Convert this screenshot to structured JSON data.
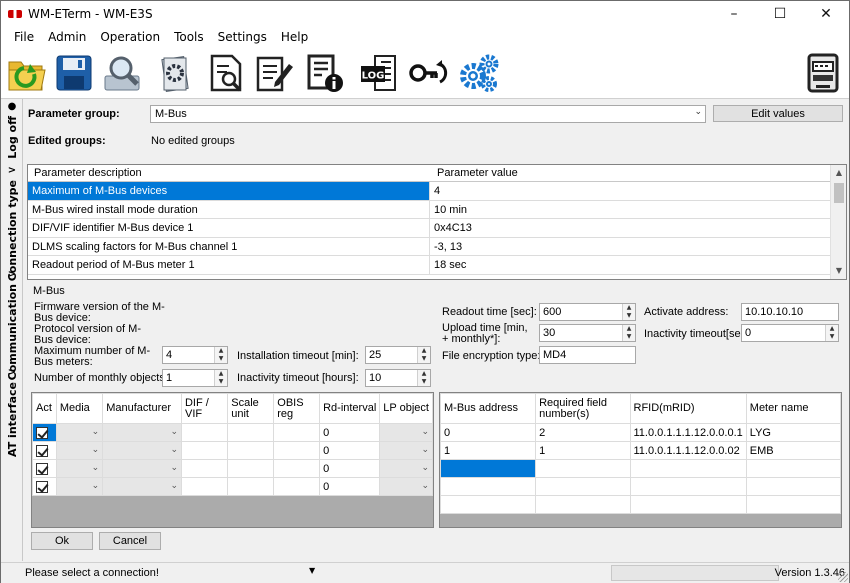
{
  "window": {
    "title": "WM-ETerm - WM-E3S"
  },
  "menu": [
    "File",
    "Admin",
    "Operation",
    "Tools",
    "Settings",
    "Help"
  ],
  "toolbar": {
    "log_label": "LOG"
  },
  "sidetabs": [
    "Log off",
    "Connection type",
    "Communication",
    "AT interface"
  ],
  "param_group": {
    "label": "Parameter group:",
    "value": "M-Bus",
    "edit_button": "Edit values"
  },
  "edited_groups": {
    "label": "Edited groups:",
    "value": "No edited groups"
  },
  "param_table": {
    "headers": [
      "Parameter description",
      "Parameter value"
    ],
    "rows": [
      {
        "desc": "Maximum of M-Bus devices",
        "value": "4"
      },
      {
        "desc": "M-Bus wired install mode duration",
        "value": "10 min"
      },
      {
        "desc": "DIF/VIF identifier M-Bus device 1",
        "value": "0x4C13"
      },
      {
        "desc": "DLMS scaling factors for M-Bus channel 1",
        "value": "-3, 13"
      },
      {
        "desc": "Readout period of M-Bus meter 1",
        "value": "18 sec"
      }
    ]
  },
  "mbus": {
    "group_title": "M-Bus",
    "firmware_label": "Firmware version of the M-Bus device:",
    "protocol_label": "Protocol version of M-Bus device:",
    "max_meters_label": "Maximum number of M-Bus meters:",
    "max_meters_value": "4",
    "monthly_objects_label": "Number of monthly objects:",
    "monthly_objects_value": "1",
    "install_timeout_label": "Installation timeout [min]:",
    "install_timeout_value": "25",
    "inactivity_hours_label": "Inactivity timeout [hours]:",
    "inactivity_hours_value": "10",
    "readout_time_label": "Readout time [sec]:",
    "readout_time_value": "600",
    "upload_time_label": "Upload time [min, + monthly*]:",
    "upload_time_value": "30",
    "file_encryption_label": "File encryption type:",
    "file_encryption_value": "MD4",
    "activate_address_label": "Activate address:",
    "activate_address_value": "10.10.10.10",
    "inactivity_sec_label": "Inactivity timeout[sec]:",
    "inactivity_sec_value": "0"
  },
  "left_grid": {
    "headers": [
      "Act",
      "Media",
      "Manufacturer",
      "DIF / VIF",
      "Scale unit",
      "OBIS reg",
      "Rd-interval",
      "LP object"
    ],
    "rows": [
      {
        "rd": "0"
      },
      {
        "rd": "0"
      },
      {
        "rd": "0"
      },
      {
        "rd": "0"
      }
    ]
  },
  "right_grid": {
    "headers": [
      "M-Bus address",
      "Required field number(s)",
      "RFID(mRID)",
      "Meter name"
    ],
    "rows": [
      {
        "addr": "0",
        "req": "2",
        "rfid": "11.0.0.1.1.1.12.0.0.0.1",
        "name": "LYG"
      },
      {
        "addr": "1",
        "req": "1",
        "rfid": "11.0.0.1.1.1.12.0.0.02",
        "name": "EMB"
      }
    ]
  },
  "buttons": {
    "ok": "Ok",
    "cancel": "Cancel"
  },
  "status": {
    "text": "Please select a connection!",
    "version": "Version 1.3.46"
  }
}
